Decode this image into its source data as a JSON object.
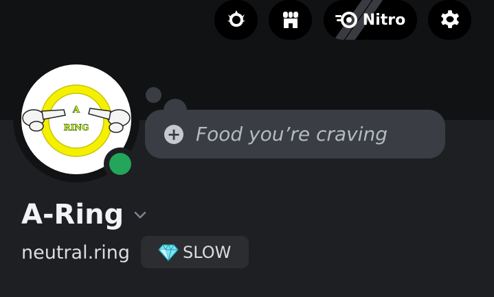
{
  "header": {
    "nitro_label": "Nitro",
    "icons": [
      "quests-icon",
      "shop-icon",
      "nitro-icon",
      "gear-icon"
    ]
  },
  "profile": {
    "avatar": {
      "text_top": "A",
      "text_bottom": "RING"
    },
    "status": "online",
    "status_bubble_placeholder": "Food you’re craving",
    "display_name": "A-Ring",
    "username": "neutral.ring",
    "tag": {
      "icon": "gem-icon",
      "label": "SLOW"
    }
  },
  "colors": {
    "banner": "#111214",
    "background": "#1e1f22",
    "bubble": "#3b3d44",
    "online": "#23a55a",
    "ring_yellow": "#f5f000"
  }
}
